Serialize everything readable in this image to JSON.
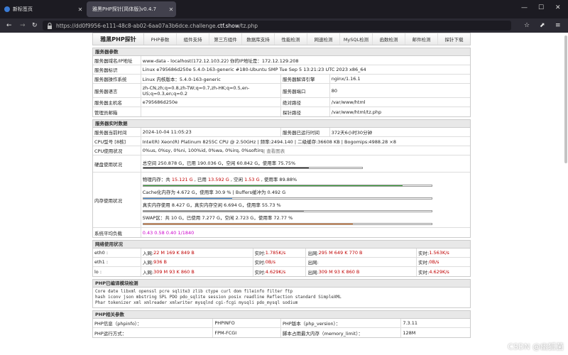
{
  "browser": {
    "tabs": [
      {
        "title": "新标签页",
        "close": "✕"
      },
      {
        "title": "雅黑PHP探针[简体版]v0.4.7",
        "close": "✕"
      }
    ],
    "window_controls": [
      "—",
      "☐",
      "✕"
    ],
    "url_prefix": "https://dd0f9956-e111-48c8-ab02-6aa07a3b6dce.challenge.",
    "url_host": "ctf.show",
    "url_path": "/tz.php"
  },
  "nav": {
    "brand": "雅黑PHP探针",
    "items": [
      "PHP参数",
      "组件支持",
      "第三方组件",
      "数据库支持",
      "性能检测",
      "网速检测",
      "MySQL检测",
      "函数检测",
      "邮件检测",
      "探针下载"
    ]
  },
  "server_params": {
    "title": "服务器参数",
    "domain_label": "服务器域名/IP地址",
    "domain_value": "www-data - localhost(172.12.103.22)  你的IP地址是：172.12.129.208",
    "ident_label": "服务器标识",
    "ident_value": "Linux e795686d250e 5.4.0-163-generic #180-Ubuntu SMP Tue Sep 5 13:21:23 UTC 2023 x86_64",
    "os_label": "服务器操作系统",
    "os_value": "Linux  内核版本：5.4.0-163-generic",
    "engine_label": "服务器解译引擎",
    "engine_value": "nginx/1.16.1",
    "lang_label": "服务器语言",
    "lang_value": "zh-CN,zh;q=0.8,zh-TW;q=0.7,zh-HK;q=0.5,en-US;q=0.3,en;q=0.2",
    "port_label": "服务器端口",
    "port_value": "80",
    "host_label": "服务器主机名",
    "host_value": "e795686d250e",
    "abspath_label": "绝对路径",
    "abspath_value": "/var/www/html",
    "admin_label": "管理员邮箱",
    "admin_value": "",
    "probepath_label": "探针路径",
    "probepath_value": "/var/www/html/tz.php"
  },
  "realtime": {
    "title": "服务器实时数据",
    "time_label": "服务器当前时间",
    "time_value": "2024-10-04 11:05:23",
    "uptime_label": "服务器已运行时间",
    "uptime_value": "372天6小时30分钟",
    "cpu_label": "CPU型号 [8核]",
    "cpu_value": "Intel(R) Xeon(R) Platinum 8255C CPU @ 2.50GHz | 频率:2494.140 | 二级缓存:36608 KB | Bogomips:4988.28 ×8",
    "cpuuse_label": "CPU使用状况",
    "cpuuse_value": "0%us, 0%sy, 0%ni, 100%id, 0%wa, 0%irq, 0%softirq",
    "cpuuse_link": " | 查看图表",
    "disk_label": "硬盘使用状况",
    "disk_value": "总空间 250.878 G，已用 190.036 G，空闲 60.842 G，使用率 75.75%",
    "disk_pct": 75.75,
    "mem_label": "内存使用状况",
    "phys_a": "物理内存：共 ",
    "phys_total": "15.121 G",
    "phys_b": " , 已用 ",
    "phys_used": "13.592 G",
    "phys_c": " , 空闲 ",
    "phys_free": "1.53 G",
    "phys_d": " , 使用率 89.88%",
    "phys_pct": 89.88,
    "cache_value": "Cache化内存为 4.672 G，使用率 30.9 % | Buffers缓冲为 0.492 G",
    "cache_pct": 30.9,
    "real_value": "真实内存使用 8.427 G，真实内存空闲 6.694 G，使用率 55.73 %",
    "real_pct": 55.73,
    "swap_value": "SWAP区：共 10 G，已使用 7.277 G，空闲 2.723 G，使用率 72.77 %",
    "swap_pct": 72.77,
    "load_label": "系统平均负载",
    "load_value": "0.43 0.58 0.40 1/1840"
  },
  "network": {
    "title": "网络使用状况",
    "rows": [
      {
        "iface": "eth0 :",
        "in_label": "入网: ",
        "in": "22 M 169 K 849 B",
        "rt_label": "实时: ",
        "rt_in": "1.785K/s",
        "out_label": "出网: ",
        "out": "295 M 649 K 770 B",
        "rt2_label": "实时: ",
        "rt_out": "1.563K/s"
      },
      {
        "iface": "eth1 :",
        "in_label": "入网: ",
        "in": "936 B",
        "rt_label": "实时: ",
        "rt_in": "0B/s",
        "out_label": "出网: ",
        "out": "",
        "rt2_label": "实时: ",
        "rt_out": "0B/s"
      },
      {
        "iface": "lo :",
        "in_label": "入网: ",
        "in": "309 M 93 K 860 B",
        "rt_label": "实时: ",
        "rt_in": "4.629K/s",
        "out_label": "出网: ",
        "out": "309 M 93 K 860 B",
        "rt2_label": "实时: ",
        "rt_out": "4.629K/s"
      }
    ]
  },
  "modules": {
    "title": "PHP已编译模块检测",
    "line1": "Core  date  libxml  openssl  pcre  sqlite3  zlib  ctype  curl  dom  fileinfo  filter  ftp",
    "line2": "hash  iconv  json  mbstring  SPL  PDO  pdo_sqlite  session  posix  readline  Reflection  standard  SimpleXML",
    "line3": "Phar  tokenizer  xml  xmlreader  xmlwriter  mysqlnd  cgi-fcgi  mysqli  pdo_mysql  sodium"
  },
  "php": {
    "title": "PHP相关参数",
    "info_label": "PHP信息（phpinfo）：",
    "info_value": "PHPINFO",
    "version_label": "PHP版本（php_version）：",
    "version_value": "7.3.11",
    "mode_label": "PHP运行方式：",
    "mode_value": "FPM-FCGI",
    "memlimit_label": "脚本占用最大内存（memory_limit）：",
    "memlimit_value": "128M"
  },
  "watermark": "CSDN @幽狐菌"
}
